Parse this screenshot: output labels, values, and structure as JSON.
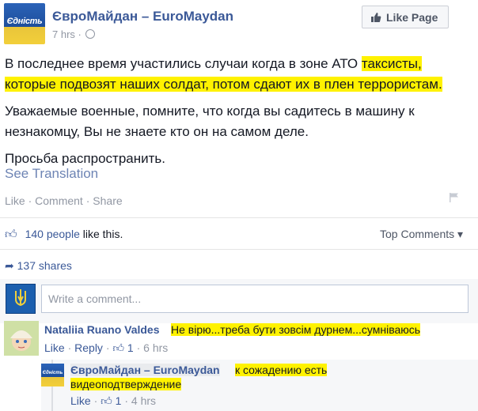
{
  "post": {
    "page_name": "ЄвроМайдан – EuroMaydan",
    "avatar_text": "Єдність",
    "time": "7 hrs ·",
    "like_page_label": "Like Page",
    "body_line1_pre": "В последнее время участились случаи когда в зоне АТО ",
    "body_line1_hl": "таксисты, которые подвозят наших солдат, потом сдают их в плен террористам.",
    "body_para2": "Уважаемые военные, помните, что когда вы садитесь в машину к незнакомцу, Вы не знаете кто он на самом деле.",
    "body_para3": "Просьба распространить.",
    "see_translation": "See Translation",
    "actions": {
      "like": "Like",
      "comment": "Comment",
      "share": "Share",
      "dot": "·"
    }
  },
  "stats": {
    "likes_count": "140 people",
    "likes_suffix": " like this.",
    "top_comments": "Top Comments ▾",
    "shares": "137 shares"
  },
  "comment_box": {
    "placeholder": "Write a comment..."
  },
  "comments": [
    {
      "author": "Nataliia Ruano Valdes",
      "text": "Не вірю...треба бути зовсім дурнем...сумніваюсь",
      "like": "Like",
      "reply": "Reply",
      "likes": "1",
      "time": "6 hrs",
      "dot": "·"
    }
  ],
  "reply": {
    "author": "ЄвроМайдан – EuroMaydan",
    "avatar_text": "Єдність",
    "text_1": "к сожадению есть",
    "text_2": "видеоподтверждение",
    "like": "Like",
    "likes": "1",
    "time": "4 hrs",
    "dot": "·"
  },
  "colors": {
    "link": "#3b5998",
    "highlight": "#fff200",
    "meta": "#9197a3"
  }
}
